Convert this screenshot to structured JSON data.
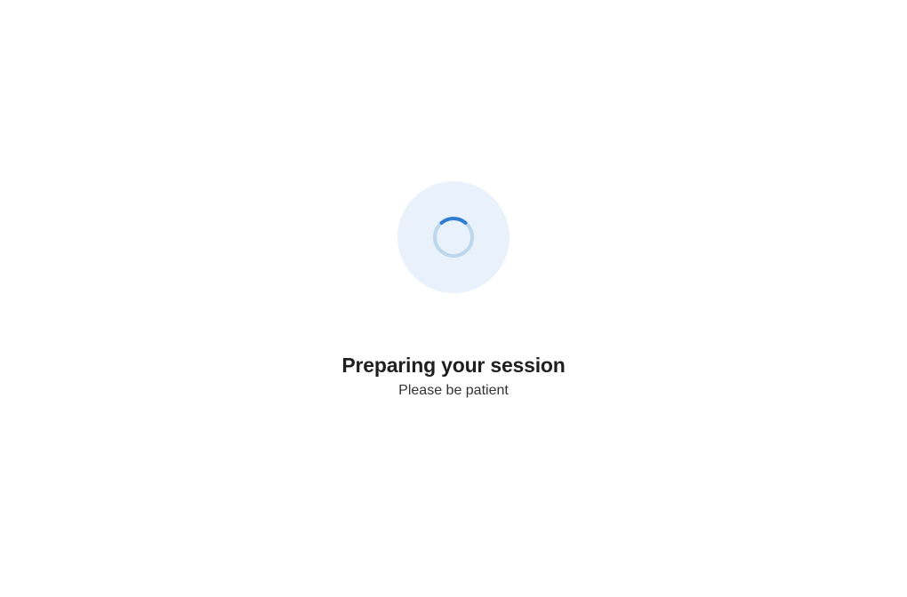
{
  "loading": {
    "heading": "Preparing your session",
    "subtext": "Please be patient"
  },
  "colors": {
    "spinner_bg": "#e9f2fa",
    "spinner_track": "#bdd8ed",
    "spinner_arc": "#2f7cd0"
  }
}
